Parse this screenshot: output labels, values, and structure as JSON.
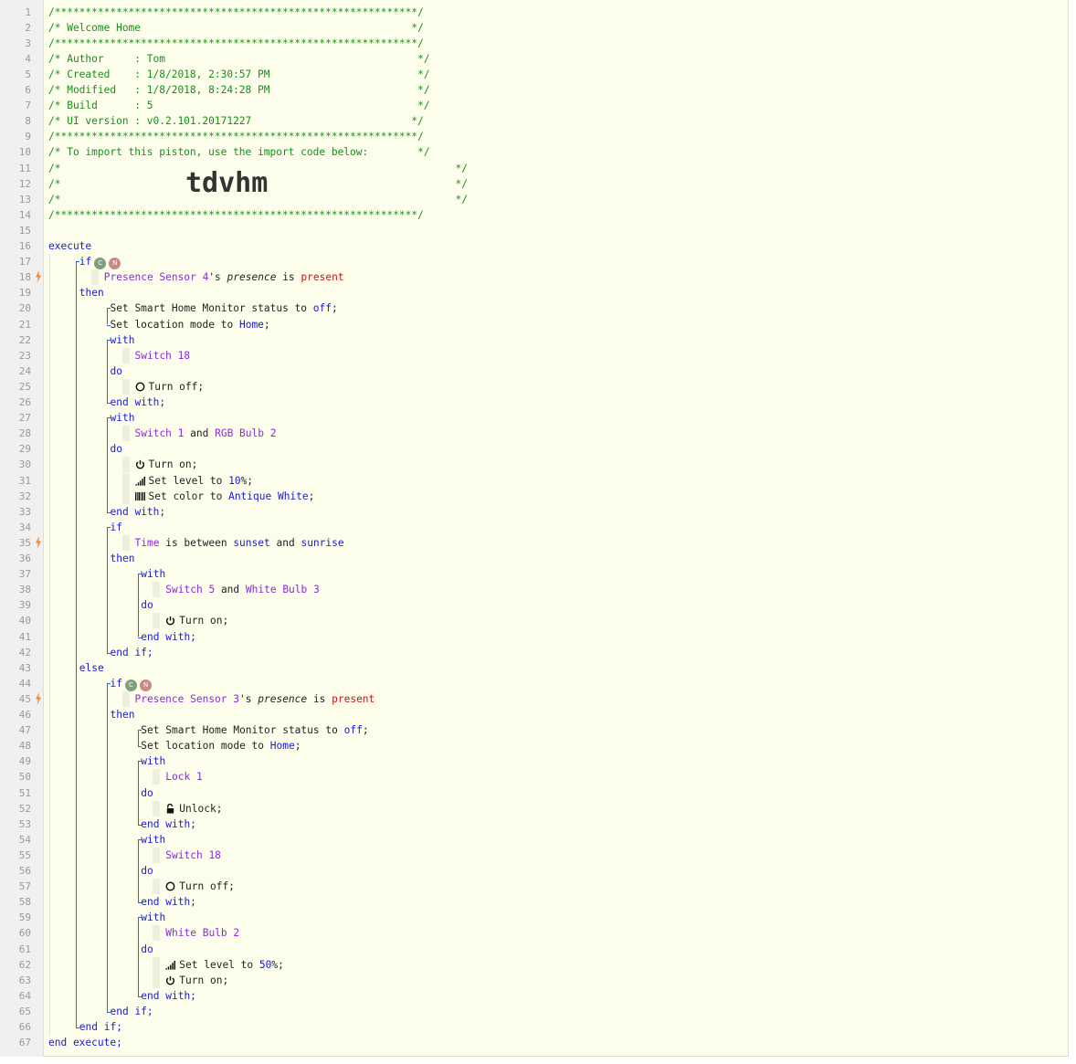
{
  "header": {
    "rule": "/***********************************************************/",
    "title_line": "/* Welcome Home                                            */",
    "author_line": "/* Author     : Tom                                         */",
    "created_line": "/* Created    : 1/8/2018, 2:30:57 PM                        */",
    "modified_line": "/* Modified   : 1/8/2018, 8:24:28 PM                        */",
    "build_line": "/* Build      : 5                                           */",
    "ui_line": "/* UI version : v0.2.101.20171227                          */",
    "import_line": "/* To import this piston, use the import code below:        */",
    "blank_line_open": "/*",
    "blank_line_close": "*/",
    "import_code": "tdvhm"
  },
  "keywords": {
    "execute": "execute",
    "if": "if",
    "then": "then",
    "else": "else",
    "with": "with",
    "do": "do",
    "end_with": "end with;",
    "end_if": "end if;",
    "end_execute": "end execute;",
    "and": "and",
    "to": "to"
  },
  "badges": {
    "c": "C",
    "n": "N"
  },
  "lines": {
    "l18": {
      "device": "Presence Sensor 4",
      "poss": "'s",
      "attr": "presence",
      "is": "is",
      "value": "present"
    },
    "l20": {
      "text": "Set Smart Home Monitor status to",
      "value": "off",
      "end": ";"
    },
    "l21": {
      "text": "Set location mode to",
      "value": "Home",
      "end": ";"
    },
    "l23": {
      "device": "Switch 18"
    },
    "l25": {
      "text": "Turn off;"
    },
    "l28": {
      "device1": "Switch 1",
      "device2": "RGB Bulb 2"
    },
    "l30": {
      "text": "Turn on;"
    },
    "l31": {
      "text": "Set level to",
      "value": "10",
      "end": "%;"
    },
    "l32": {
      "text": "Set color to",
      "value": "Antique White",
      "end": ";"
    },
    "l35": {
      "device": "Time",
      "text": "is between",
      "v1": "sunset",
      "v2": "sunrise"
    },
    "l38": {
      "device1": "Switch 5",
      "device2": "White Bulb 3"
    },
    "l40": {
      "text": "Turn on;"
    },
    "l45": {
      "device": "Presence Sensor 3",
      "poss": "'s",
      "attr": "presence",
      "is": "is",
      "value": "present"
    },
    "l47": {
      "text": "Set Smart Home Monitor status to",
      "value": "off",
      "end": ";"
    },
    "l48": {
      "text": "Set location mode to",
      "value": "Home",
      "end": ";"
    },
    "l50": {
      "device": "Lock 1"
    },
    "l52": {
      "text": "Unlock;"
    },
    "l55": {
      "device": "Switch 18"
    },
    "l57": {
      "text": "Turn off;"
    },
    "l60": {
      "device": "White Bulb 2"
    },
    "l62": {
      "text": "Set level to",
      "value": "50",
      "end": "%;"
    },
    "l63": {
      "text": "Turn on;"
    }
  },
  "line_numbers": [
    "1",
    "2",
    "3",
    "4",
    "5",
    "6",
    "7",
    "8",
    "9",
    "10",
    "11",
    "12",
    "13",
    "14",
    "15",
    "16",
    "17",
    "18",
    "19",
    "20",
    "21",
    "22",
    "23",
    "24",
    "25",
    "26",
    "27",
    "28",
    "29",
    "30",
    "31",
    "32",
    "33",
    "34",
    "35",
    "36",
    "37",
    "38",
    "39",
    "40",
    "41",
    "42",
    "43",
    "44",
    "45",
    "46",
    "47",
    "48",
    "49",
    "50",
    "51",
    "52",
    "53",
    "54",
    "55",
    "56",
    "57",
    "58",
    "59",
    "60",
    "61",
    "62",
    "63",
    "64",
    "65",
    "66",
    "67"
  ],
  "colors": {
    "background": "#fdfdeb",
    "comment": "#1a8f1a",
    "keyword": "#1a1ad6",
    "device": "#8a2be2",
    "string_value": "#c0181a",
    "guide": "#2a6bd1",
    "bolt": "#f08a30"
  }
}
